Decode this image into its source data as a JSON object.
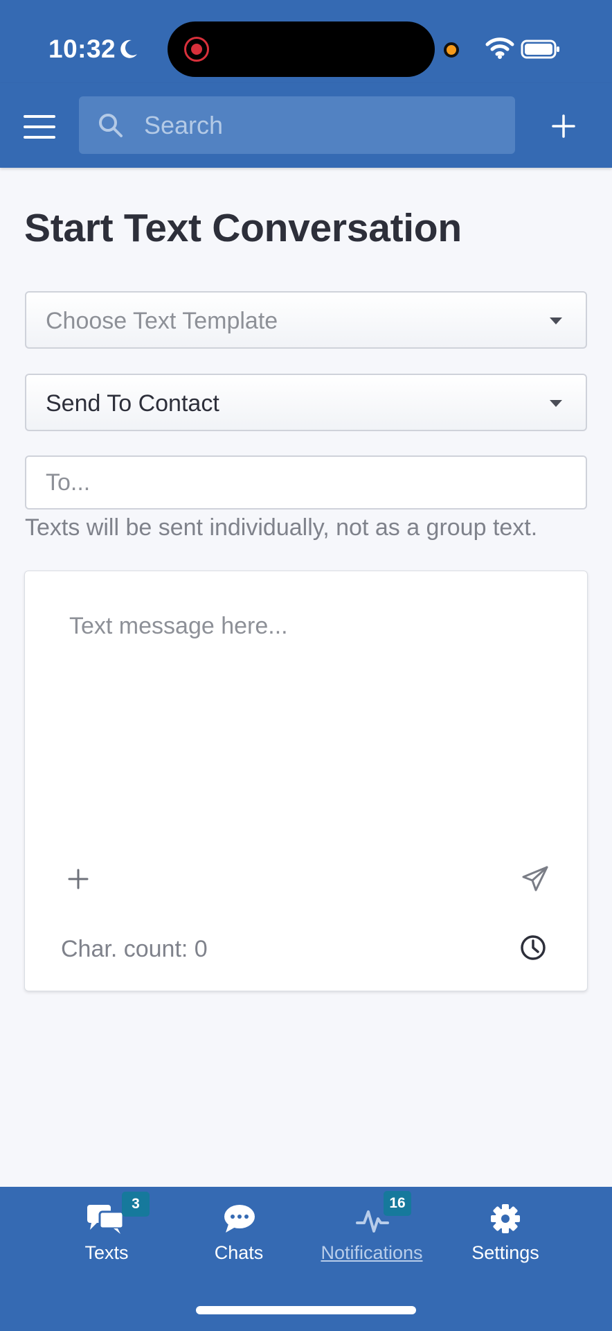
{
  "status_bar": {
    "time": "10:32"
  },
  "app_bar": {
    "search_placeholder": "Search"
  },
  "main": {
    "title": "Start Text Conversation",
    "template_select": {
      "placeholder": "Choose Text Template"
    },
    "send_to_select": {
      "selected": "Send To Contact"
    },
    "to_field": {
      "placeholder": "To..."
    },
    "helper_text": "Texts will be sent individually, not as a group text.",
    "message": {
      "placeholder": "Text message here...",
      "char_count": "Char. count: 0"
    }
  },
  "tab_bar": {
    "items": [
      {
        "label": "Texts",
        "icon": "texts-icon",
        "badge": "3",
        "active": false
      },
      {
        "label": "Chats",
        "icon": "chat-bubble-icon",
        "badge": "",
        "active": false
      },
      {
        "label": "Notifications",
        "icon": "activity-icon",
        "badge": "16",
        "active": true
      },
      {
        "label": "Settings",
        "icon": "gear-icon",
        "badge": "",
        "active": false
      }
    ]
  },
  "colors": {
    "primary": "#356ab3",
    "search_bg": "#5282c2",
    "badge": "#16799c",
    "page_bg": "#f6f7fb",
    "title_text": "#2d2f3a",
    "muted_text": "#7f828b"
  }
}
